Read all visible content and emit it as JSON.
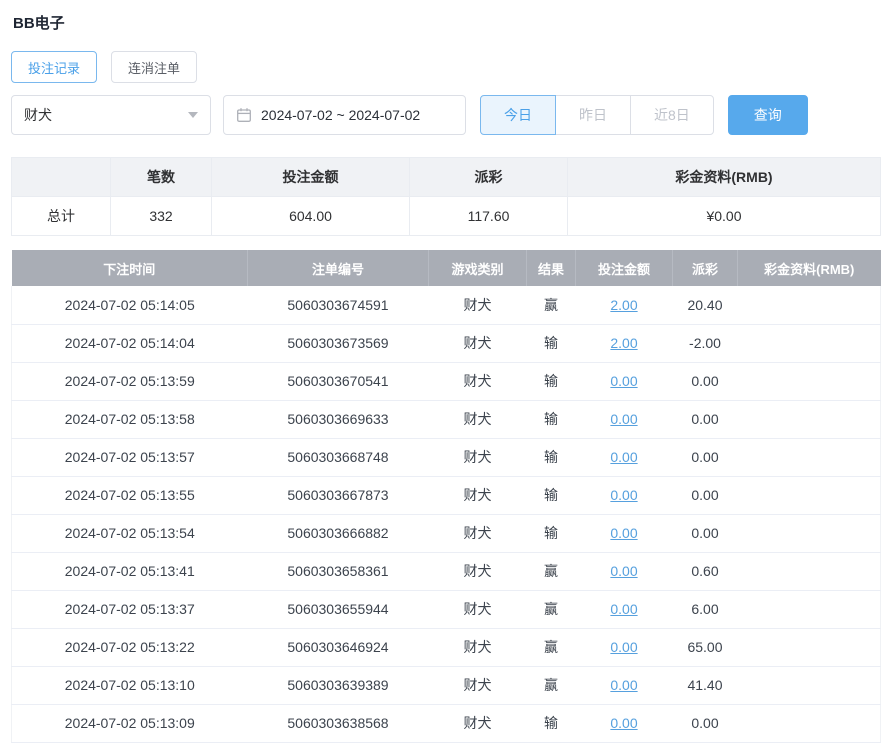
{
  "page": {
    "title": "BB电子"
  },
  "tabs": [
    {
      "label": "投注记录",
      "active": true
    },
    {
      "label": "连消注单",
      "active": false
    }
  ],
  "filters": {
    "game_select_value": "财犬",
    "date_range": "2024-07-02 ~ 2024-07-02",
    "quick_buttons": [
      {
        "label": "今日",
        "active": true
      },
      {
        "label": "昨日",
        "active": false
      },
      {
        "label": "近8日",
        "active": false
      }
    ],
    "query_label": "查询"
  },
  "summary": {
    "headers": [
      "",
      "笔数",
      "投注金额",
      "派彩",
      "彩金资料(RMB)"
    ],
    "total": {
      "label": "总计",
      "count": "332",
      "bet_amount": "604.00",
      "payout": "117.60",
      "bonus": "¥0.00"
    }
  },
  "table": {
    "headers": [
      "下注时间",
      "注单编号",
      "游戏类别",
      "结果",
      "投注金额",
      "派彩",
      "彩金资料(RMB)"
    ],
    "rows": [
      {
        "time": "2024-07-02 05:14:05",
        "order": "5060303674591",
        "game": "财犬",
        "result": "赢",
        "bet": "2.00",
        "payout": "20.40",
        "bonus": ""
      },
      {
        "time": "2024-07-02 05:14:04",
        "order": "5060303673569",
        "game": "财犬",
        "result": "输",
        "bet": "2.00",
        "payout": "-2.00",
        "bonus": ""
      },
      {
        "time": "2024-07-02 05:13:59",
        "order": "5060303670541",
        "game": "财犬",
        "result": "输",
        "bet": "0.00",
        "payout": "0.00",
        "bonus": ""
      },
      {
        "time": "2024-07-02 05:13:58",
        "order": "5060303669633",
        "game": "财犬",
        "result": "输",
        "bet": "0.00",
        "payout": "0.00",
        "bonus": ""
      },
      {
        "time": "2024-07-02 05:13:57",
        "order": "5060303668748",
        "game": "财犬",
        "result": "输",
        "bet": "0.00",
        "payout": "0.00",
        "bonus": ""
      },
      {
        "time": "2024-07-02 05:13:55",
        "order": "5060303667873",
        "game": "财犬",
        "result": "输",
        "bet": "0.00",
        "payout": "0.00",
        "bonus": ""
      },
      {
        "time": "2024-07-02 05:13:54",
        "order": "5060303666882",
        "game": "财犬",
        "result": "输",
        "bet": "0.00",
        "payout": "0.00",
        "bonus": ""
      },
      {
        "time": "2024-07-02 05:13:41",
        "order": "5060303658361",
        "game": "财犬",
        "result": "赢",
        "bet": "0.00",
        "payout": "0.60",
        "bonus": ""
      },
      {
        "time": "2024-07-02 05:13:37",
        "order": "5060303655944",
        "game": "财犬",
        "result": "赢",
        "bet": "0.00",
        "payout": "6.00",
        "bonus": ""
      },
      {
        "time": "2024-07-02 05:13:22",
        "order": "5060303646924",
        "game": "财犬",
        "result": "赢",
        "bet": "0.00",
        "payout": "65.00",
        "bonus": ""
      },
      {
        "time": "2024-07-02 05:13:10",
        "order": "5060303639389",
        "game": "财犬",
        "result": "赢",
        "bet": "0.00",
        "payout": "41.40",
        "bonus": ""
      },
      {
        "time": "2024-07-02 05:13:09",
        "order": "5060303638568",
        "game": "财犬",
        "result": "输",
        "bet": "0.00",
        "payout": "0.00",
        "bonus": ""
      }
    ]
  },
  "colors": {
    "accent": "#4aa0e8",
    "accent_bg": "#eaf4fd",
    "table_header_bg": "#a9adb5",
    "link": "#56a0de",
    "negative": "#e2504c"
  }
}
